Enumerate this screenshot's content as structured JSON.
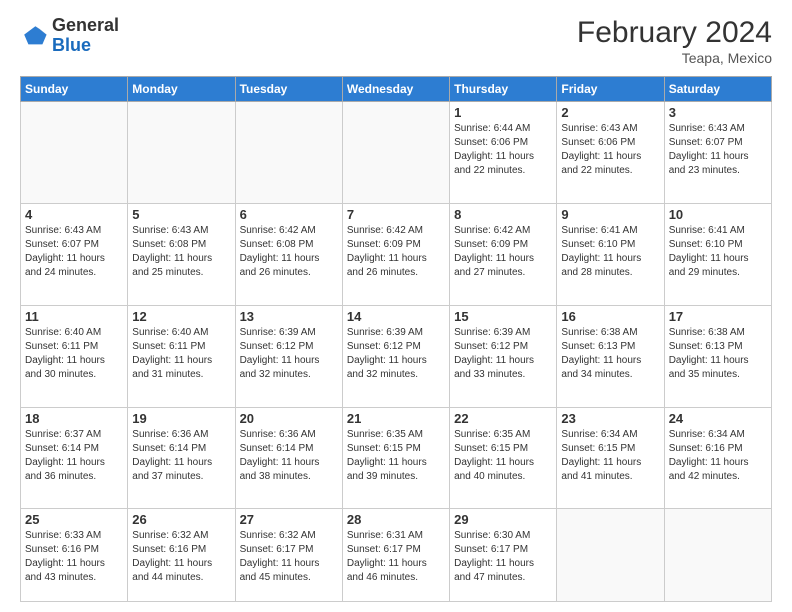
{
  "header": {
    "logo_general": "General",
    "logo_blue": "Blue",
    "month_year": "February 2024",
    "location": "Teapa, Mexico"
  },
  "weekdays": [
    "Sunday",
    "Monday",
    "Tuesday",
    "Wednesday",
    "Thursday",
    "Friday",
    "Saturday"
  ],
  "weeks": [
    [
      {
        "day": "",
        "info": ""
      },
      {
        "day": "",
        "info": ""
      },
      {
        "day": "",
        "info": ""
      },
      {
        "day": "",
        "info": ""
      },
      {
        "day": "1",
        "info": "Sunrise: 6:44 AM\nSunset: 6:06 PM\nDaylight: 11 hours\nand 22 minutes."
      },
      {
        "day": "2",
        "info": "Sunrise: 6:43 AM\nSunset: 6:06 PM\nDaylight: 11 hours\nand 22 minutes."
      },
      {
        "day": "3",
        "info": "Sunrise: 6:43 AM\nSunset: 6:07 PM\nDaylight: 11 hours\nand 23 minutes."
      }
    ],
    [
      {
        "day": "4",
        "info": "Sunrise: 6:43 AM\nSunset: 6:07 PM\nDaylight: 11 hours\nand 24 minutes."
      },
      {
        "day": "5",
        "info": "Sunrise: 6:43 AM\nSunset: 6:08 PM\nDaylight: 11 hours\nand 25 minutes."
      },
      {
        "day": "6",
        "info": "Sunrise: 6:42 AM\nSunset: 6:08 PM\nDaylight: 11 hours\nand 26 minutes."
      },
      {
        "day": "7",
        "info": "Sunrise: 6:42 AM\nSunset: 6:09 PM\nDaylight: 11 hours\nand 26 minutes."
      },
      {
        "day": "8",
        "info": "Sunrise: 6:42 AM\nSunset: 6:09 PM\nDaylight: 11 hours\nand 27 minutes."
      },
      {
        "day": "9",
        "info": "Sunrise: 6:41 AM\nSunset: 6:10 PM\nDaylight: 11 hours\nand 28 minutes."
      },
      {
        "day": "10",
        "info": "Sunrise: 6:41 AM\nSunset: 6:10 PM\nDaylight: 11 hours\nand 29 minutes."
      }
    ],
    [
      {
        "day": "11",
        "info": "Sunrise: 6:40 AM\nSunset: 6:11 PM\nDaylight: 11 hours\nand 30 minutes."
      },
      {
        "day": "12",
        "info": "Sunrise: 6:40 AM\nSunset: 6:11 PM\nDaylight: 11 hours\nand 31 minutes."
      },
      {
        "day": "13",
        "info": "Sunrise: 6:39 AM\nSunset: 6:12 PM\nDaylight: 11 hours\nand 32 minutes."
      },
      {
        "day": "14",
        "info": "Sunrise: 6:39 AM\nSunset: 6:12 PM\nDaylight: 11 hours\nand 32 minutes."
      },
      {
        "day": "15",
        "info": "Sunrise: 6:39 AM\nSunset: 6:12 PM\nDaylight: 11 hours\nand 33 minutes."
      },
      {
        "day": "16",
        "info": "Sunrise: 6:38 AM\nSunset: 6:13 PM\nDaylight: 11 hours\nand 34 minutes."
      },
      {
        "day": "17",
        "info": "Sunrise: 6:38 AM\nSunset: 6:13 PM\nDaylight: 11 hours\nand 35 minutes."
      }
    ],
    [
      {
        "day": "18",
        "info": "Sunrise: 6:37 AM\nSunset: 6:14 PM\nDaylight: 11 hours\nand 36 minutes."
      },
      {
        "day": "19",
        "info": "Sunrise: 6:36 AM\nSunset: 6:14 PM\nDaylight: 11 hours\nand 37 minutes."
      },
      {
        "day": "20",
        "info": "Sunrise: 6:36 AM\nSunset: 6:14 PM\nDaylight: 11 hours\nand 38 minutes."
      },
      {
        "day": "21",
        "info": "Sunrise: 6:35 AM\nSunset: 6:15 PM\nDaylight: 11 hours\nand 39 minutes."
      },
      {
        "day": "22",
        "info": "Sunrise: 6:35 AM\nSunset: 6:15 PM\nDaylight: 11 hours\nand 40 minutes."
      },
      {
        "day": "23",
        "info": "Sunrise: 6:34 AM\nSunset: 6:15 PM\nDaylight: 11 hours\nand 41 minutes."
      },
      {
        "day": "24",
        "info": "Sunrise: 6:34 AM\nSunset: 6:16 PM\nDaylight: 11 hours\nand 42 minutes."
      }
    ],
    [
      {
        "day": "25",
        "info": "Sunrise: 6:33 AM\nSunset: 6:16 PM\nDaylight: 11 hours\nand 43 minutes."
      },
      {
        "day": "26",
        "info": "Sunrise: 6:32 AM\nSunset: 6:16 PM\nDaylight: 11 hours\nand 44 minutes."
      },
      {
        "day": "27",
        "info": "Sunrise: 6:32 AM\nSunset: 6:17 PM\nDaylight: 11 hours\nand 45 minutes."
      },
      {
        "day": "28",
        "info": "Sunrise: 6:31 AM\nSunset: 6:17 PM\nDaylight: 11 hours\nand 46 minutes."
      },
      {
        "day": "29",
        "info": "Sunrise: 6:30 AM\nSunset: 6:17 PM\nDaylight: 11 hours\nand 47 minutes."
      },
      {
        "day": "",
        "info": ""
      },
      {
        "day": "",
        "info": ""
      }
    ]
  ]
}
